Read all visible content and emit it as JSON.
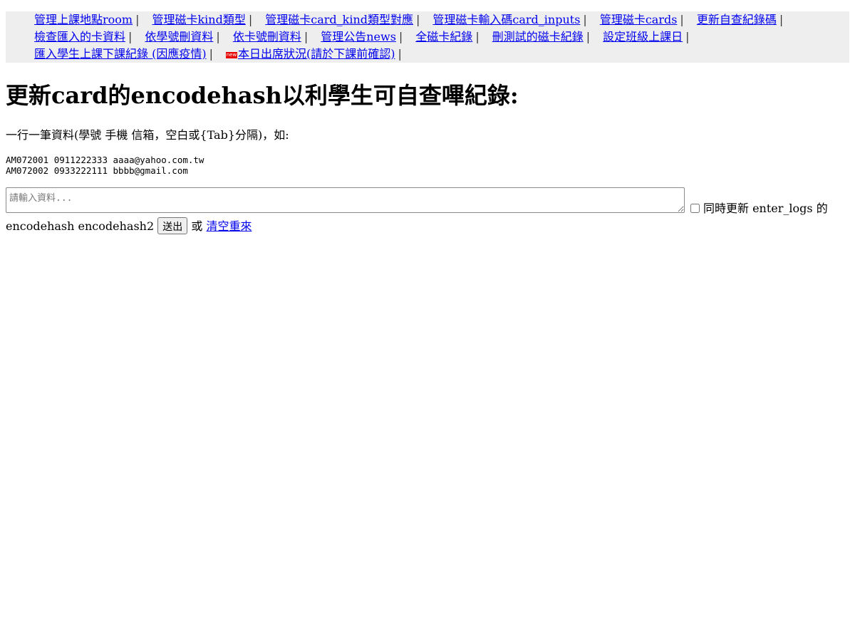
{
  "nav": {
    "rows": [
      [
        {
          "label": "管理上課地點room",
          "sep": "|"
        },
        {
          "label": "管理磁卡kind類型",
          "sep": "|"
        },
        {
          "label": "管理磁卡card_kind類型對應",
          "sep": "|"
        },
        {
          "label": "管理磁卡輸入碼card_inputs",
          "sep": "|"
        },
        {
          "label": "管理磁卡cards",
          "sep": "|"
        },
        {
          "label": "更新自查紀錄碼",
          "sep": "|"
        }
      ],
      [
        {
          "label": "檢查匯入的卡資料",
          "sep": "|"
        },
        {
          "label": "依學號刪資料",
          "sep": "|"
        },
        {
          "label": "依卡號刪資料",
          "sep": "|"
        },
        {
          "label": "管理公告news",
          "sep": "|"
        },
        {
          "label": "全磁卡紀錄",
          "sep": "|"
        },
        {
          "label": "刪測試的磁卡紀錄",
          "sep": "|"
        },
        {
          "label": "設定班級上課日",
          "sep": "|"
        }
      ],
      [
        {
          "label": "匯入學生上課下課紀錄 (因應疫情)",
          "sep": "|"
        },
        {
          "label": "本日出席狀況(請於下課前確認)",
          "sep": "|",
          "badge": "new"
        }
      ]
    ]
  },
  "page": {
    "title": "更新card的encodehash以利學生可自查嗶紀錄:",
    "instruction": "一行一筆資料(學號 手機 信箱，空白或{Tab}分隔)，如:",
    "example_lines": [
      "AM072001 0911222333 aaaa@yahoo.com.tw",
      "AM072002 0933222111 bbbb@gmail.com"
    ]
  },
  "form": {
    "textarea_placeholder": "請輸入資料...",
    "textarea_value": "",
    "checkbox_checked": false,
    "checkbox_label": "同時更新 enter_logs 的",
    "checkbox_label_cont": "encodehash encodehash2",
    "submit_label": "送出",
    "or_text": "或",
    "reset_label": "清空重來"
  }
}
